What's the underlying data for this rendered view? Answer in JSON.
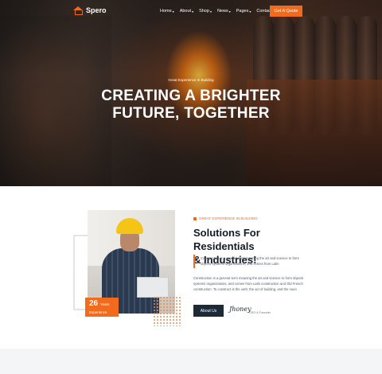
{
  "brand": {
    "name": "Spero",
    "accent": "#f26b1d",
    "dark": "#1c2a38"
  },
  "nav": {
    "items": [
      {
        "label": "Home",
        "has_dropdown": true
      },
      {
        "label": "About",
        "has_dropdown": true
      },
      {
        "label": "Shop",
        "has_dropdown": true
      },
      {
        "label": "News",
        "has_dropdown": true
      },
      {
        "label": "Pages",
        "has_dropdown": true
      },
      {
        "label": "Contact",
        "has_dropdown": false
      }
    ],
    "cta_label": "Get A Quote"
  },
  "hero": {
    "kicker": "Great Experience In Building",
    "title_line1": "CREATING A BRIGHTER",
    "title_line2": "FUTURE, TOGETHER"
  },
  "about": {
    "experience_number": "26",
    "experience_unit": "Years",
    "experience_label": "Experience",
    "eyebrow": "GREAT EXPERIENCE IN BUILDING",
    "title_line1": "Solutions For Residentials",
    "title_line2": "& Industries!",
    "quote": "Construction is a general term meaning the art and science to form objects systems organizations, and comes from Latin",
    "body": "Construction is a general term meaning the art and science to form objects systems organizations, and comes from Latin construction and Old French construction. To construct is the verb: the act of building, and the noun",
    "button_label": "About Us",
    "signature": "Jhoney",
    "signature_role": "CEO & Founder"
  }
}
